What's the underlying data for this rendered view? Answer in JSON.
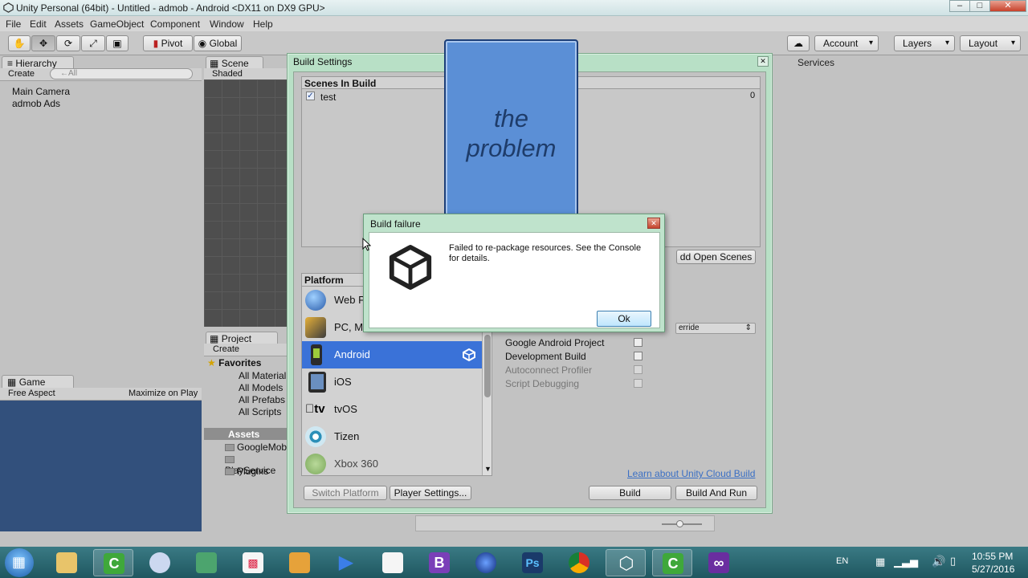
{
  "window": {
    "title": "Unity Personal (64bit) - Untitled - admob - Android <DX11 on DX9 GPU>"
  },
  "menu": [
    "File",
    "Edit",
    "Assets",
    "GameObject",
    "Component",
    "Window",
    "Help"
  ],
  "toolbar": {
    "pivot": "Pivot",
    "global": "Global",
    "account": "Account",
    "layers": "Layers",
    "layout": "Layout"
  },
  "hierarchy": {
    "tab": "Hierarchy",
    "create": "Create",
    "search_placeholder": "←All",
    "items": [
      "Main Camera",
      "admob Ads"
    ]
  },
  "scene": {
    "tab": "Scene",
    "shading": "Shaded"
  },
  "services": {
    "tab": "Services"
  },
  "project": {
    "tab": "Project",
    "create": "Create",
    "favorites_label": "Favorites",
    "favorites": [
      "All Material",
      "All Models",
      "All Prefabs",
      "All Scripts"
    ],
    "assets_label": "Assets",
    "folders": [
      "GoogleMob",
      "PlayService",
      "Plugins"
    ]
  },
  "game": {
    "tab": "Game",
    "aspect": "Free Aspect",
    "maximize": "Maximize on Play"
  },
  "build_settings": {
    "title": "Build Settings",
    "scenes_header": "Scenes In Build",
    "scenes": [
      {
        "name": "test",
        "index": "0"
      }
    ],
    "add_open_scenes": "dd Open Scenes",
    "platform_header": "Platform",
    "platforms": [
      "Web P",
      "PC, Ma",
      "Android",
      "iOS",
      "tvOS",
      "Tizen",
      "Xbox 360"
    ],
    "selected_platform": "Android",
    "override": "erride",
    "options": [
      {
        "label": "Google Android Project",
        "enabled": true
      },
      {
        "label": "Development Build",
        "enabled": true
      },
      {
        "label": "Autoconnect Profiler",
        "enabled": false
      },
      {
        "label": "Script Debugging",
        "enabled": false
      }
    ],
    "cloud_link": "Learn about Unity Cloud Build",
    "switch_platform": "Switch Platform",
    "player_settings": "Player Settings...",
    "build": "Build",
    "build_and_run": "Build And Run"
  },
  "overlay": {
    "line1": "the",
    "line2": "problem"
  },
  "dialog": {
    "title": "Build failure",
    "message": "Failed to re-package resources. See the Console for details.",
    "ok": "Ok"
  },
  "tray": {
    "lang": "EN",
    "time": "10:55 PM",
    "date": "5/27/2016"
  },
  "colors": {
    "accent_selection": "#3a72d8",
    "game_view": "#32507c",
    "overlay_card": "#5b8fd6",
    "taskbar": "#2a6a74"
  }
}
